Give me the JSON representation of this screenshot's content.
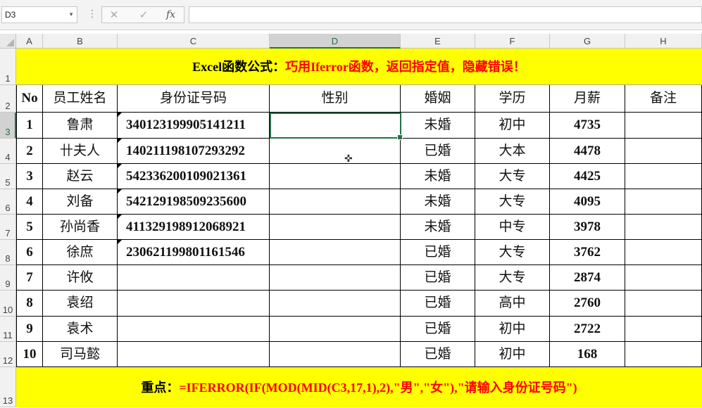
{
  "name_box": "D3",
  "formula_icons": [
    "cancel-icon",
    "confirm-icon",
    "function-icon"
  ],
  "fx_label": "fx",
  "formula_value": "",
  "columns": [
    "A",
    "B",
    "C",
    "D",
    "E",
    "F",
    "G",
    "H"
  ],
  "rows": [
    "1",
    "2",
    "3",
    "4",
    "5",
    "6",
    "7",
    "8",
    "9",
    "10",
    "11",
    "12",
    "13"
  ],
  "selected": {
    "column": "D",
    "row": "3"
  },
  "title": {
    "black": "Excel函数公式：",
    "red": "巧用Iferror函数，返回指定值，隐藏错误！"
  },
  "headers": [
    "No",
    "员工姓名",
    "身份证号码",
    "性别",
    "婚姻",
    "学历",
    "月薪",
    "备注"
  ],
  "table_rows": [
    {
      "no": "1",
      "name": "鲁肃",
      "id": "340123199905141211",
      "gender": "",
      "marital": "未婚",
      "edu": "初中",
      "salary": "4735",
      "note": ""
    },
    {
      "no": "2",
      "name": "卄夫人",
      "id": "140211198107293292",
      "gender": "",
      "marital": "已婚",
      "edu": "大本",
      "salary": "4478",
      "note": ""
    },
    {
      "no": "3",
      "name": "赵云",
      "id": "542336200109021361",
      "gender": "",
      "marital": "未婚",
      "edu": "大专",
      "salary": "4425",
      "note": ""
    },
    {
      "no": "4",
      "name": "刘备",
      "id": "542129198509235600",
      "gender": "",
      "marital": "未婚",
      "edu": "大专",
      "salary": "4095",
      "note": ""
    },
    {
      "no": "5",
      "name": "孙尚香",
      "id": "411329198912068921",
      "gender": "",
      "marital": "未婚",
      "edu": "中专",
      "salary": "3978",
      "note": ""
    },
    {
      "no": "6",
      "name": "徐庶",
      "id": "230621199801161546",
      "gender": "",
      "marital": "已婚",
      "edu": "大专",
      "salary": "3762",
      "note": ""
    },
    {
      "no": "7",
      "name": "许攸",
      "id": "",
      "gender": "",
      "marital": "已婚",
      "edu": "大专",
      "salary": "2874",
      "note": ""
    },
    {
      "no": "8",
      "name": "袁绍",
      "id": "",
      "gender": "",
      "marital": "已婚",
      "edu": "高中",
      "salary": "2760",
      "note": ""
    },
    {
      "no": "9",
      "name": "袁术",
      "id": "",
      "gender": "",
      "marital": "已婚",
      "edu": "初中",
      "salary": "2722",
      "note": ""
    },
    {
      "no": "10",
      "name": "司马懿",
      "id": "",
      "gender": "",
      "marital": "已婚",
      "edu": "初中",
      "salary": "168",
      "note": ""
    }
  ],
  "footer": {
    "black": "重点：",
    "red": "=IFERROR(IF(MOD(MID(C3,17,1),2),\"男\",\"女\"),\"请输入身份证号码\")"
  },
  "colors": {
    "banner": "#ffff00",
    "accent_red": "#ff0000",
    "selection": "#217346"
  }
}
